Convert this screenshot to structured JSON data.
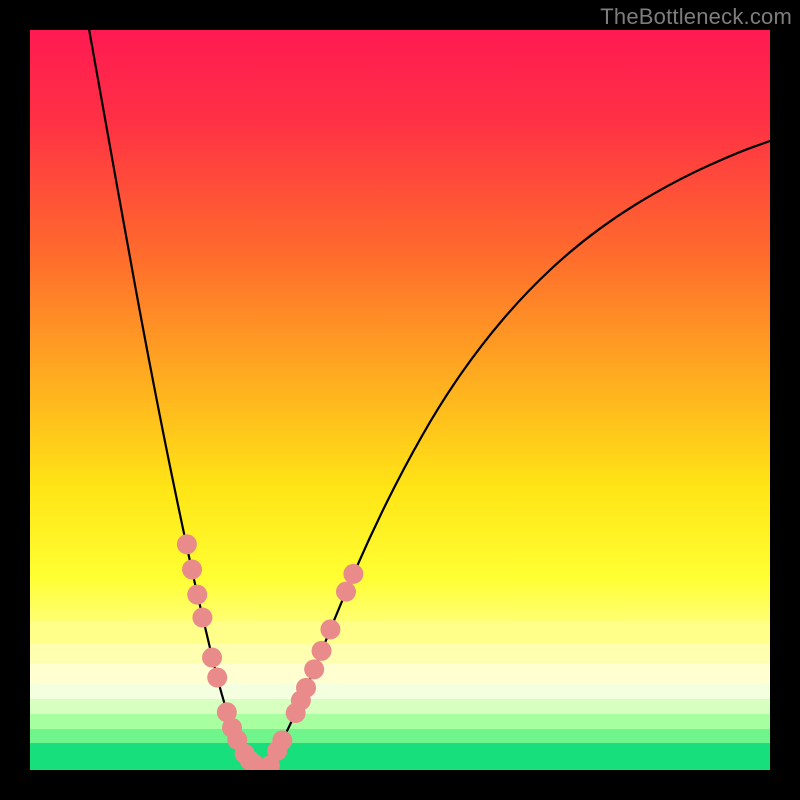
{
  "watermark": "TheBottleneck.com",
  "chart_data": {
    "type": "line",
    "title": "",
    "xlabel": "",
    "ylabel": "",
    "xlim": [
      0,
      100
    ],
    "ylim": [
      0,
      100
    ],
    "grid": false,
    "legend": false,
    "background": {
      "type": "vertical-gradient",
      "stops": [
        {
          "pos": 0.0,
          "color": "#ff1a52"
        },
        {
          "pos": 0.12,
          "color": "#ff3045"
        },
        {
          "pos": 0.3,
          "color": "#ff6a2d"
        },
        {
          "pos": 0.48,
          "color": "#ffb01f"
        },
        {
          "pos": 0.62,
          "color": "#ffe516"
        },
        {
          "pos": 0.74,
          "color": "#ffff33"
        },
        {
          "pos": 0.82,
          "color": "#ffff8a"
        },
        {
          "pos": 0.86,
          "color": "#ffffc2"
        },
        {
          "pos": 0.885,
          "color": "#f4ffd8"
        },
        {
          "pos": 0.905,
          "color": "#d6ffbd"
        },
        {
          "pos": 0.93,
          "color": "#9dff9a"
        },
        {
          "pos": 0.955,
          "color": "#55f080"
        },
        {
          "pos": 0.975,
          "color": "#1fe47a"
        },
        {
          "pos": 1.0,
          "color": "#0fdc78"
        }
      ]
    },
    "series": [
      {
        "name": "left-branch",
        "values": [
          {
            "x": 8.0,
            "y": 100.0
          },
          {
            "x": 10.5,
            "y": 86.0
          },
          {
            "x": 13.0,
            "y": 72.0
          },
          {
            "x": 15.5,
            "y": 58.4
          },
          {
            "x": 18.0,
            "y": 45.5
          },
          {
            "x": 20.2,
            "y": 34.8
          },
          {
            "x": 22.2,
            "y": 25.5
          },
          {
            "x": 24.0,
            "y": 17.8
          },
          {
            "x": 25.5,
            "y": 11.6
          },
          {
            "x": 27.0,
            "y": 6.6
          },
          {
            "x": 28.5,
            "y": 3.1
          },
          {
            "x": 30.0,
            "y": 1.0
          },
          {
            "x": 31.3,
            "y": 0.2
          }
        ]
      },
      {
        "name": "right-branch",
        "values": [
          {
            "x": 31.3,
            "y": 0.2
          },
          {
            "x": 33.2,
            "y": 2.2
          },
          {
            "x": 35.5,
            "y": 6.8
          },
          {
            "x": 38.5,
            "y": 13.8
          },
          {
            "x": 42.0,
            "y": 22.5
          },
          {
            "x": 46.0,
            "y": 31.7
          },
          {
            "x": 50.5,
            "y": 40.8
          },
          {
            "x": 55.5,
            "y": 49.6
          },
          {
            "x": 61.0,
            "y": 57.5
          },
          {
            "x": 67.0,
            "y": 64.5
          },
          {
            "x": 73.5,
            "y": 70.6
          },
          {
            "x": 80.5,
            "y": 75.7
          },
          {
            "x": 88.0,
            "y": 80.0
          },
          {
            "x": 95.5,
            "y": 83.4
          },
          {
            "x": 100.0,
            "y": 85.0
          }
        ]
      }
    ],
    "markers": [
      {
        "x": 21.2,
        "y": 30.5,
        "series": "left-branch"
      },
      {
        "x": 21.9,
        "y": 27.1,
        "series": "left-branch"
      },
      {
        "x": 22.6,
        "y": 23.7,
        "series": "left-branch"
      },
      {
        "x": 23.3,
        "y": 20.6,
        "series": "left-branch"
      },
      {
        "x": 24.6,
        "y": 15.2,
        "series": "left-branch"
      },
      {
        "x": 25.3,
        "y": 12.5,
        "series": "left-branch"
      },
      {
        "x": 26.6,
        "y": 7.8,
        "series": "left-branch"
      },
      {
        "x": 27.3,
        "y": 5.7,
        "series": "left-branch"
      },
      {
        "x": 28.0,
        "y": 4.1,
        "series": "left-branch"
      },
      {
        "x": 29.0,
        "y": 2.2,
        "series": "left-branch"
      },
      {
        "x": 29.7,
        "y": 1.3,
        "series": "left-branch"
      },
      {
        "x": 30.3,
        "y": 0.8,
        "series": "left-branch"
      },
      {
        "x": 31.3,
        "y": 0.2,
        "series": "left-branch"
      },
      {
        "x": 32.4,
        "y": 0.6,
        "series": "right-branch"
      },
      {
        "x": 33.4,
        "y": 2.6,
        "series": "right-branch"
      },
      {
        "x": 34.1,
        "y": 4.0,
        "series": "right-branch"
      },
      {
        "x": 35.9,
        "y": 7.7,
        "series": "right-branch"
      },
      {
        "x": 36.6,
        "y": 9.4,
        "series": "right-branch"
      },
      {
        "x": 37.3,
        "y": 11.1,
        "series": "right-branch"
      },
      {
        "x": 38.4,
        "y": 13.6,
        "series": "right-branch"
      },
      {
        "x": 39.4,
        "y": 16.1,
        "series": "right-branch"
      },
      {
        "x": 40.6,
        "y": 19.0,
        "series": "right-branch"
      },
      {
        "x": 42.7,
        "y": 24.1,
        "series": "right-branch"
      },
      {
        "x": 43.7,
        "y": 26.5,
        "series": "right-branch"
      }
    ],
    "marker_style": {
      "shape": "circle",
      "radius_px": 10,
      "fill": "#e98b8a"
    }
  }
}
